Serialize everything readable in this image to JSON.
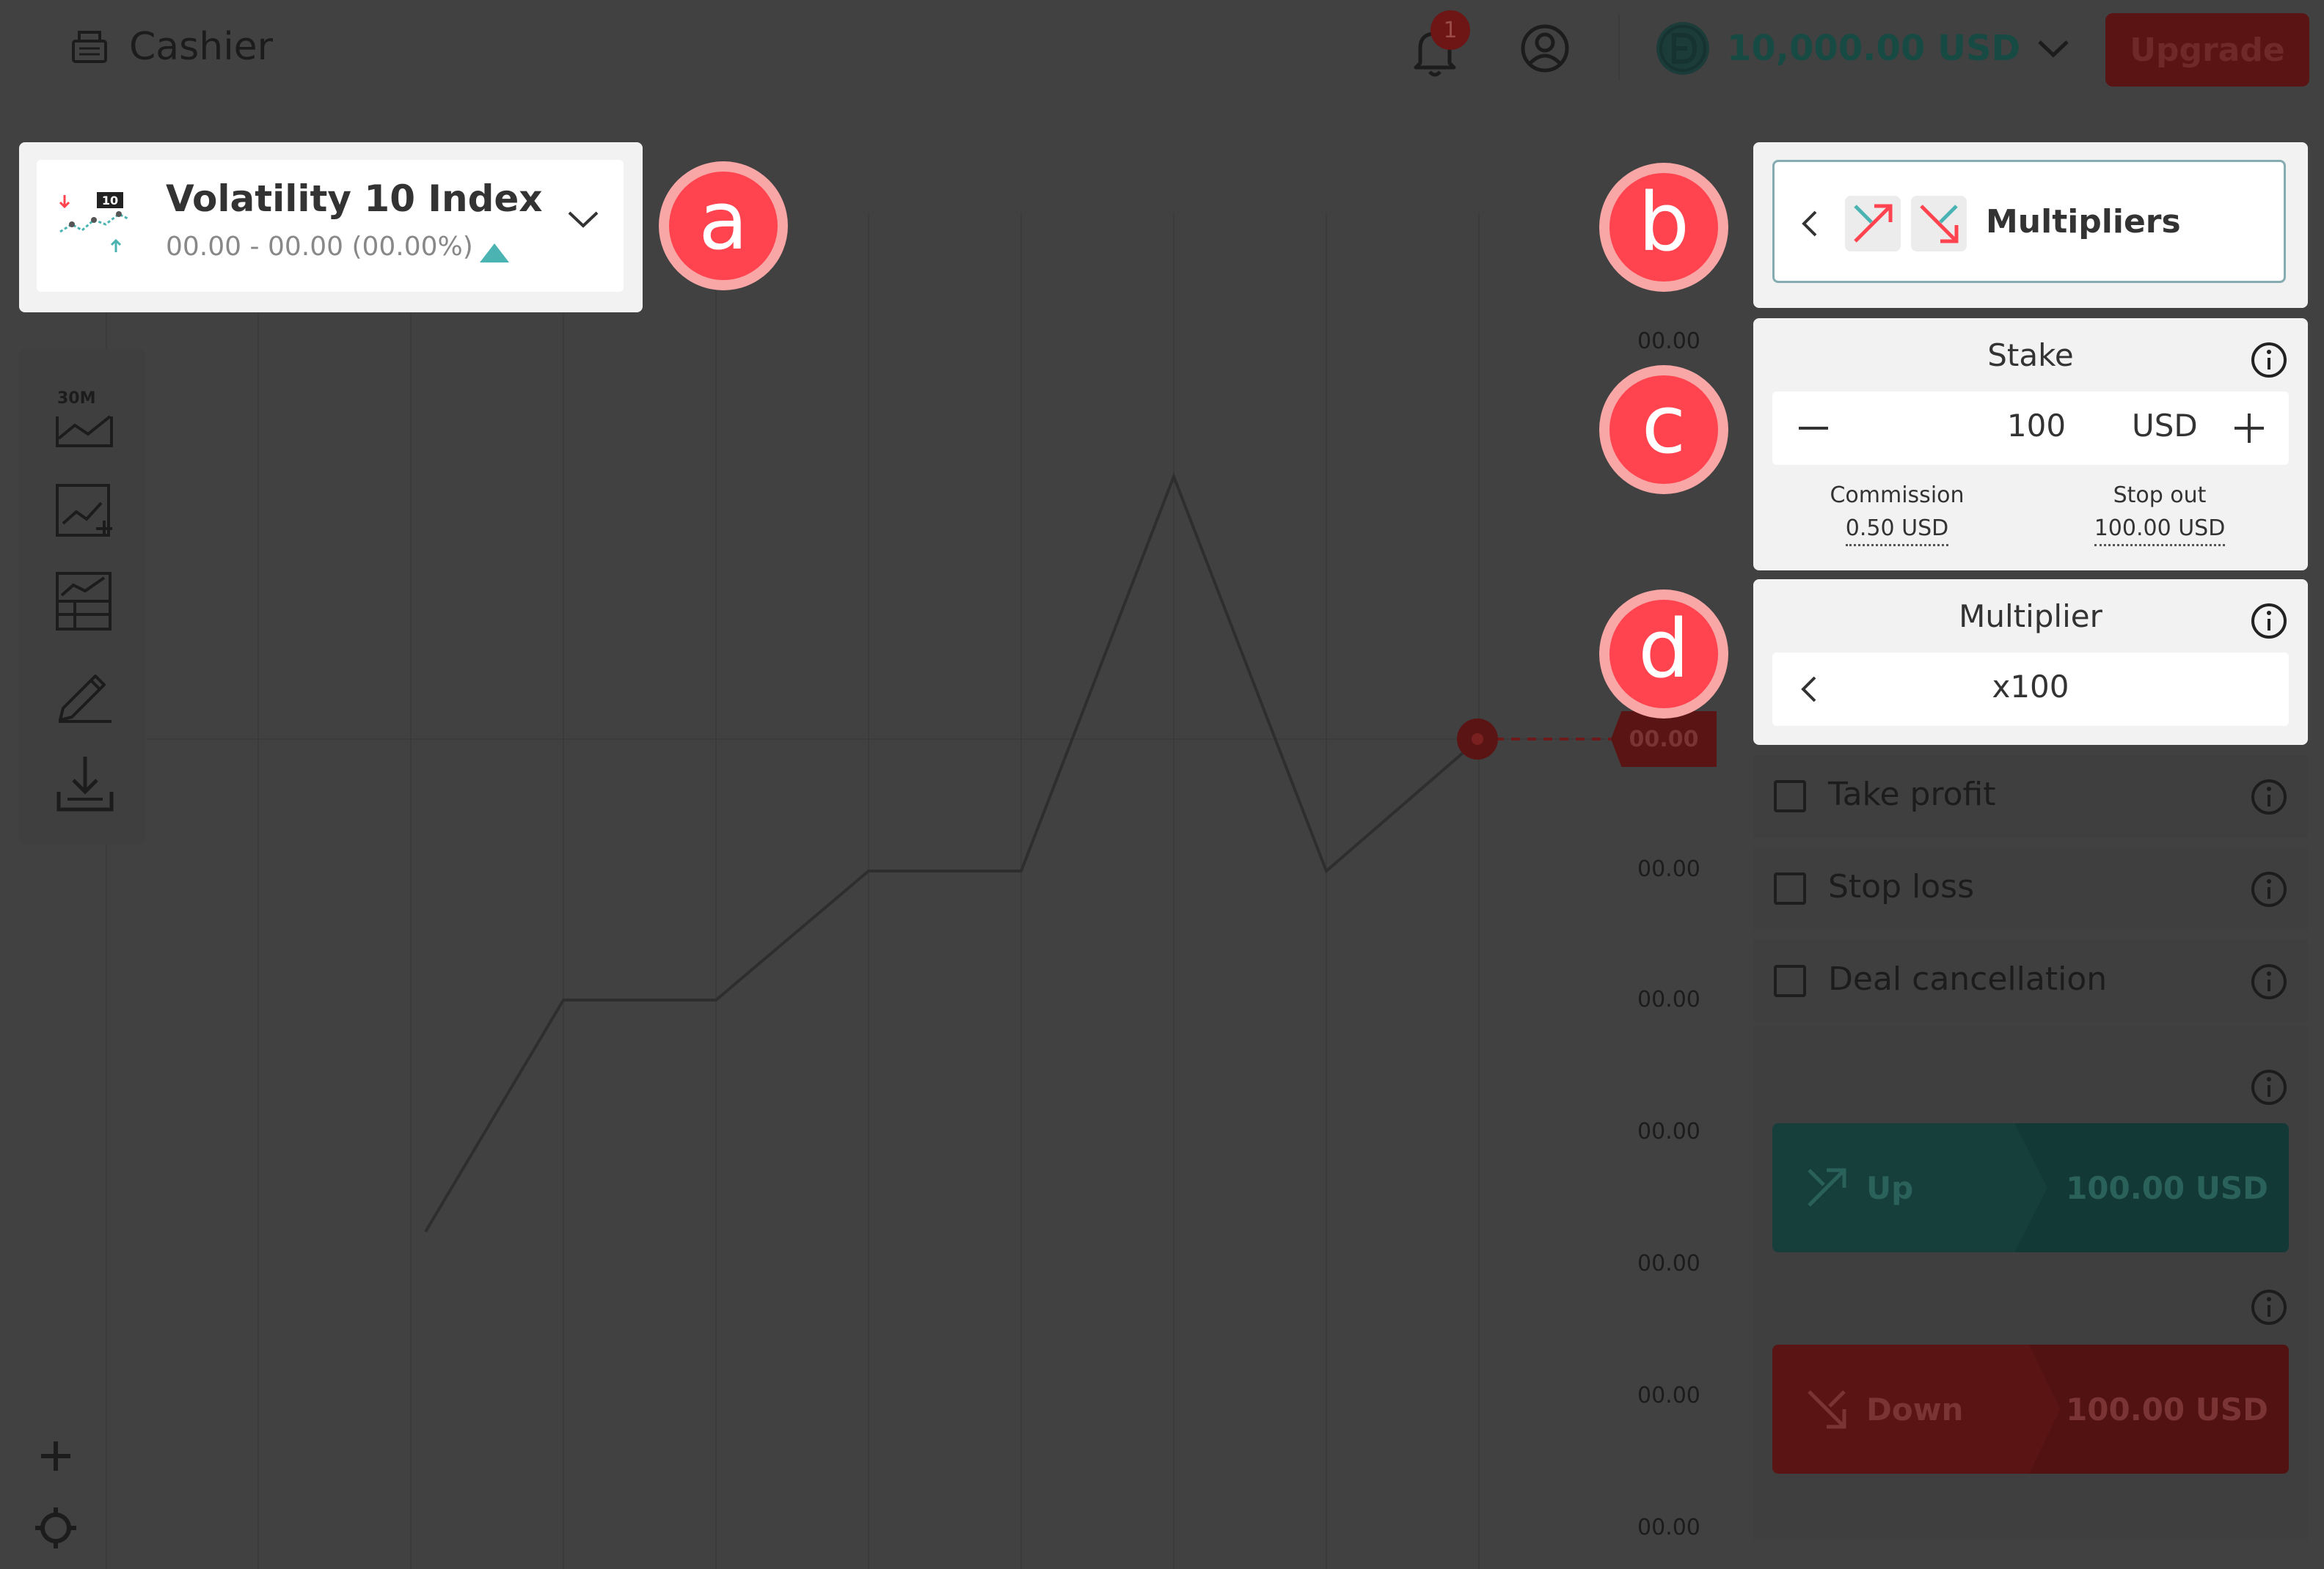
{
  "header": {
    "cashier_label": "Cashier",
    "notification_count": "1",
    "balance": "10,000.00 USD",
    "upgrade_label": "Upgrade"
  },
  "symbol": {
    "name": "Volatility 10 Index",
    "badge": "10",
    "quote": "00.00 - 00.00 (00.00%)"
  },
  "markers": {
    "a": "a",
    "b": "b",
    "c": "c",
    "d": "d"
  },
  "toolbar": {
    "interval_label": "30M"
  },
  "chart": {
    "current_price_tag": "00.00",
    "y_ticks": [
      "00.00",
      "00.00",
      "00.00",
      "00.00",
      "00.00",
      "00.00",
      "00.00",
      "00.00"
    ]
  },
  "trade_type": {
    "name": "Multipliers"
  },
  "stake": {
    "title": "Stake",
    "value": "100",
    "currency": "USD",
    "commission_label": "Commission",
    "commission_value": "0.50 USD",
    "stop_out_label": "Stop out",
    "stop_out_value": "100.00 USD"
  },
  "multiplier": {
    "title": "Multiplier",
    "value": "x100"
  },
  "options": {
    "take_profit": "Take profit",
    "stop_loss": "Stop loss",
    "deal_cancellation": "Deal cancellation"
  },
  "purchase": {
    "up_label": "Up",
    "up_amount": "100.00 USD",
    "down_label": "Down",
    "down_amount": "100.00 USD"
  },
  "colors": {
    "accent_red": "#ff444f",
    "marker_ring": "#f9a6a6",
    "teal": "#4bb4b3",
    "overlay_bg": "#414141"
  }
}
